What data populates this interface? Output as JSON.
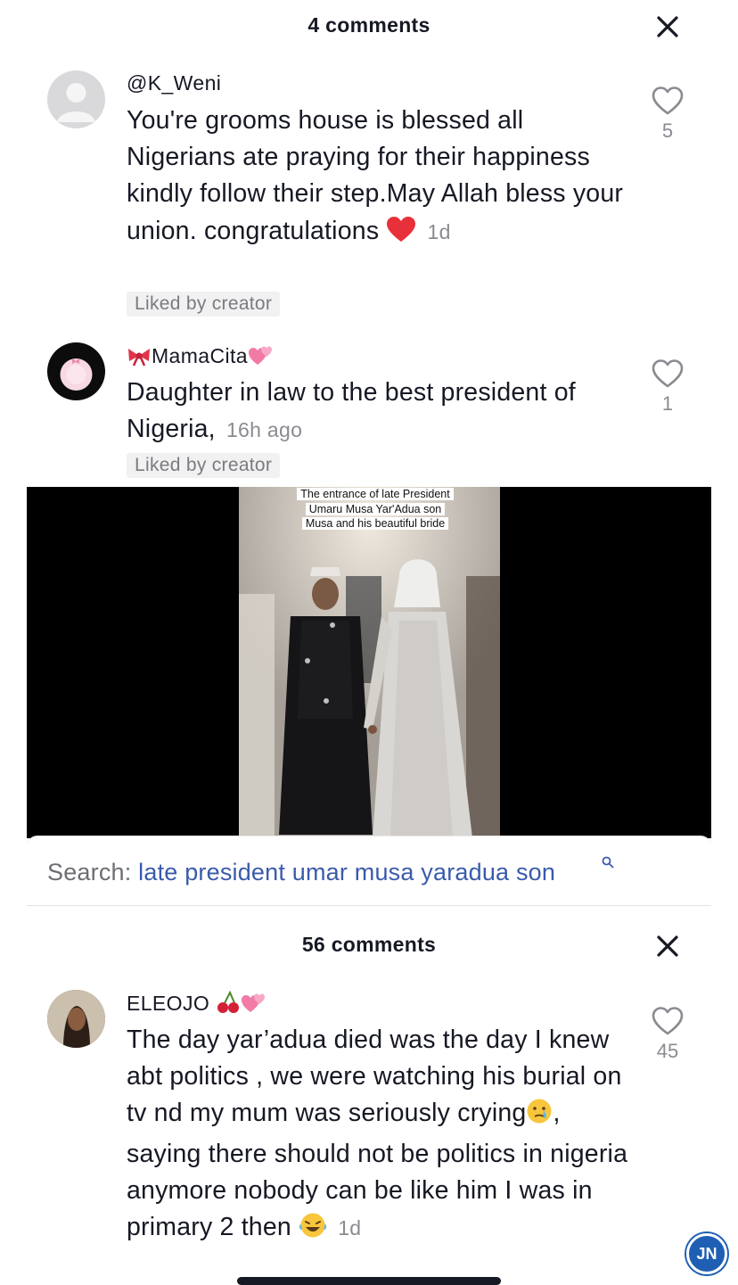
{
  "top_sheet": {
    "comment_count": "4 comments",
    "comments": [
      {
        "username": "@K_Weni",
        "text": "You're grooms house is blessed all Nigerians ate praying for their happiness kindly follow their step.May Allah bless your union. congratulations",
        "emoji": "❤️",
        "time": "1d",
        "liked_by_creator": "Liked by creator",
        "likes": "5"
      },
      {
        "username": "MamaCita",
        "text": "Daughter in law to the best president of Nigeria,",
        "time": "16h ago",
        "liked_by_creator": "Liked by creator",
        "likes": "1"
      }
    ]
  },
  "video": {
    "caption": "The entrance of late President Umaru Musa Yar'Adua son Musa and his beautiful bride"
  },
  "search": {
    "prefix": "Search:",
    "query": "late president umar musa yaradua son"
  },
  "bottom_sheet": {
    "comment_count": "56 comments",
    "comments": [
      {
        "username": "ELEOJO",
        "text_part1": "The day yar’adua died was the day I knew abt politics , we were watching his burial on tv nd my mum was seriously crying",
        "text_part2": ", saying there should not be politics in nigeria anymore nobody can be like him I was in primary 2 then",
        "time": "1d",
        "likes": "45"
      }
    ]
  },
  "watermark": "JN",
  "colors": {
    "text": "#161823",
    "muted": "#8a8b91",
    "link": "#3a5bab",
    "heart": "#e8303b"
  },
  "icons": [
    "close-icon",
    "heart-outline-icon",
    "search-small-icon",
    "bow-emoji-icon",
    "hearts-emoji-icon",
    "cherries-emoji-icon",
    "crying-face-emoji-icon",
    "laughing-face-emoji-icon",
    "red-heart-emoji-icon"
  ]
}
